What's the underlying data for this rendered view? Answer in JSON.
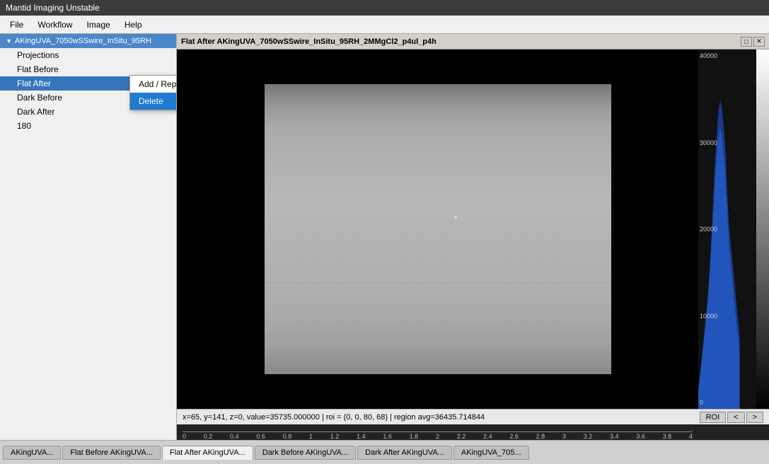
{
  "app": {
    "title": "Mantid Imaging Unstable",
    "menu": {
      "items": [
        "File",
        "Workflow",
        "Image",
        "Help"
      ]
    }
  },
  "sidebar": {
    "root_item": "AKingUVA_7050wSSwire_InSitu_95RH",
    "children": [
      "Projections",
      "Flat Before",
      "Flat After",
      "Dark Before",
      "Dark After",
      "180"
    ],
    "selected_index": 2
  },
  "context_menu": {
    "items": [
      "Add / Replace Stack",
      "Delete"
    ],
    "highlighted_index": 1
  },
  "viewer": {
    "title": "Flat After AKingUVA_7050wSSwire_InSitu_95RH_2MMgCl2_p4ul_p4h",
    "controls": [
      "□",
      "✕"
    ],
    "status": "x=65, y=141, z=0, value=35735.000000 | roi = (0, 0, 80, 68) | region avg=36435.714844",
    "roi_label": "ROI",
    "nav_prev": "<",
    "nav_next": ">",
    "scale_values": [
      "0",
      "0.2",
      "0.4",
      "0.6",
      "0.8",
      "1",
      "1.2",
      "1.4",
      "1.6",
      "1.8",
      "2",
      "2.2",
      "2.4",
      "2.6",
      "2.8",
      "3",
      "3.2",
      "3.4",
      "3.6",
      "3.8",
      "4"
    ],
    "histogram_labels": [
      "40000",
      "30000",
      "20000",
      "10000",
      "0"
    ]
  },
  "bottom_tabs": {
    "items": [
      "AKingUVA...",
      "Flat Before AKingUVA...",
      "Flat After AKingUVA...",
      "Dark Before AKingUVA...",
      "Dark After AKingUVA...",
      "AKingUVA_705..."
    ],
    "active_index": 2
  }
}
